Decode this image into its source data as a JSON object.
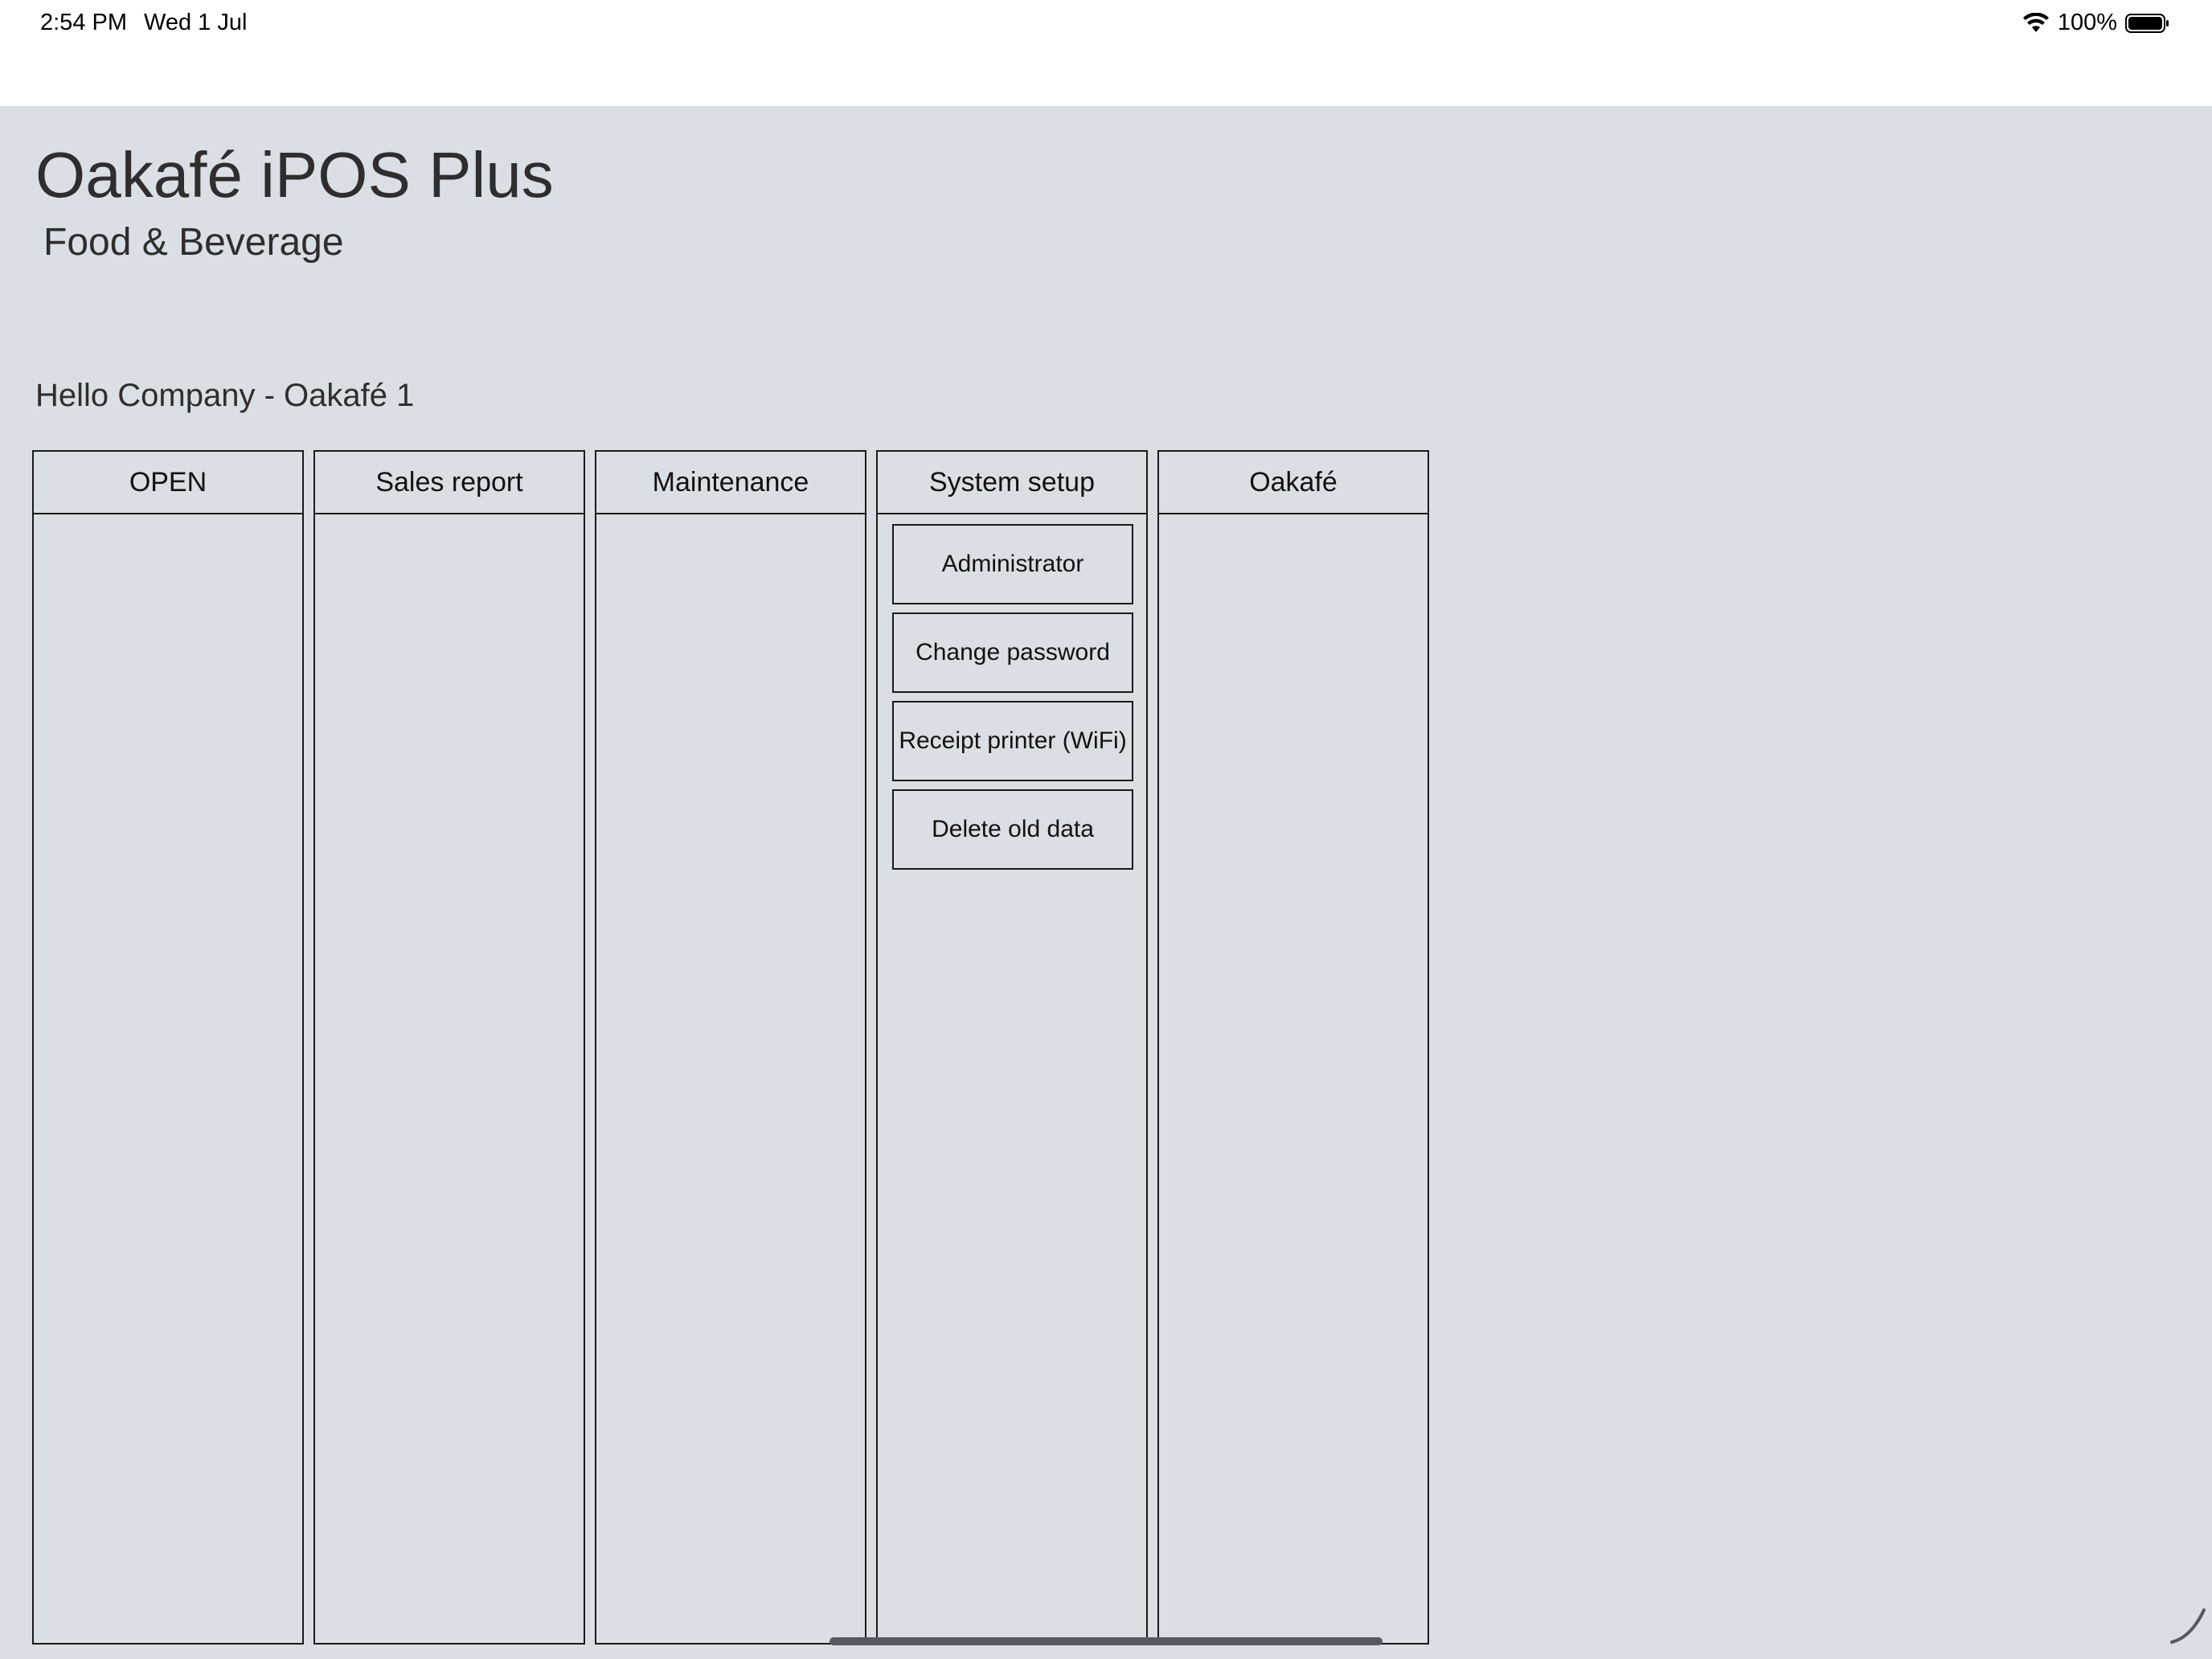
{
  "status_bar": {
    "time": "2:54 PM",
    "date": "Wed 1 Jul",
    "battery_percent": "100%",
    "wifi_icon": "wifi-icon",
    "battery_icon": "battery-icon"
  },
  "app": {
    "title": "Oakafé iPOS Plus",
    "subtitle": "Food & Beverage",
    "greeting": "Hello Company - Oakafé 1"
  },
  "columns": [
    {
      "label": "OPEN",
      "items": []
    },
    {
      "label": "Sales report",
      "items": []
    },
    {
      "label": "Maintenance",
      "items": []
    },
    {
      "label": "System setup",
      "items": [
        "Administrator",
        "Change password",
        "Receipt printer (WiFi)",
        "Delete old data"
      ]
    },
    {
      "label": "Oakafé",
      "items": []
    }
  ],
  "colors": {
    "background": "#dadfe6",
    "border": "#1a1a1a",
    "text": "#2e2e2e"
  }
}
